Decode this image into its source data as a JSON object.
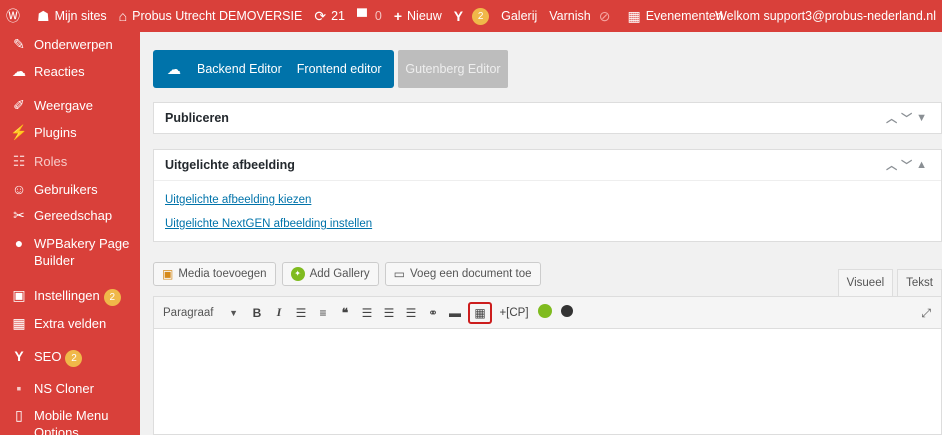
{
  "adminbar": {
    "wp_logo_icon": "wordpress-icon",
    "my_sites": "Mijn sites",
    "site_name": "Probus Utrecht DEMOVERSIE",
    "updates_count": "21",
    "comments_count": "0",
    "new_label": "Nieuw",
    "yoast_count": "2",
    "gallery_label": "Galerij",
    "varnish_label": "Varnish",
    "events_label": "Evenementen",
    "welcome": "Welkom support3@probus-nederland.nl"
  },
  "sidebar": {
    "items": [
      {
        "label": "Onderwerpen",
        "icon": "pin-icon"
      },
      {
        "label": "Reacties",
        "icon": "comments-icon"
      },
      {
        "label": "Weergave",
        "icon": "brush-icon"
      },
      {
        "label": "Plugins",
        "icon": "plug-icon"
      },
      {
        "label": "Roles",
        "icon": "group-icon"
      },
      {
        "label": "Gebruikers",
        "icon": "user-icon"
      },
      {
        "label": "Gereedschap",
        "icon": "wrench-icon"
      },
      {
        "label": "WPBakery Page Builder",
        "icon": "bakery-icon"
      },
      {
        "label": "Instellingen",
        "icon": "settings-icon",
        "badge": "2"
      },
      {
        "label": "Extra velden",
        "icon": "fields-icon"
      },
      {
        "label": "SEO",
        "icon": "yoast-icon",
        "badge": "2"
      },
      {
        "label": "NS Cloner",
        "icon": "cloner-icon"
      },
      {
        "label": "Mobile Menu Options",
        "icon": "mobile-icon"
      }
    ]
  },
  "builder": {
    "backend": "Backend Editor",
    "frontend": "Frontend editor",
    "gutenberg": "Gutenberg Editor"
  },
  "publish_box": {
    "title": "Publiceren"
  },
  "featured_box": {
    "title": "Uitgelichte afbeelding",
    "link1": "Uitgelichte afbeelding kiezen",
    "link2": "Uitgelichte NextGEN afbeelding instellen"
  },
  "editor": {
    "media_button": "Media toevoegen",
    "gallery_button": "Add Gallery",
    "document_button": "Voeg een document toe",
    "tab_visual": "Visueel",
    "tab_text": "Tekst",
    "format_select": "Paragraaf",
    "cp_button": "+[CP]"
  }
}
